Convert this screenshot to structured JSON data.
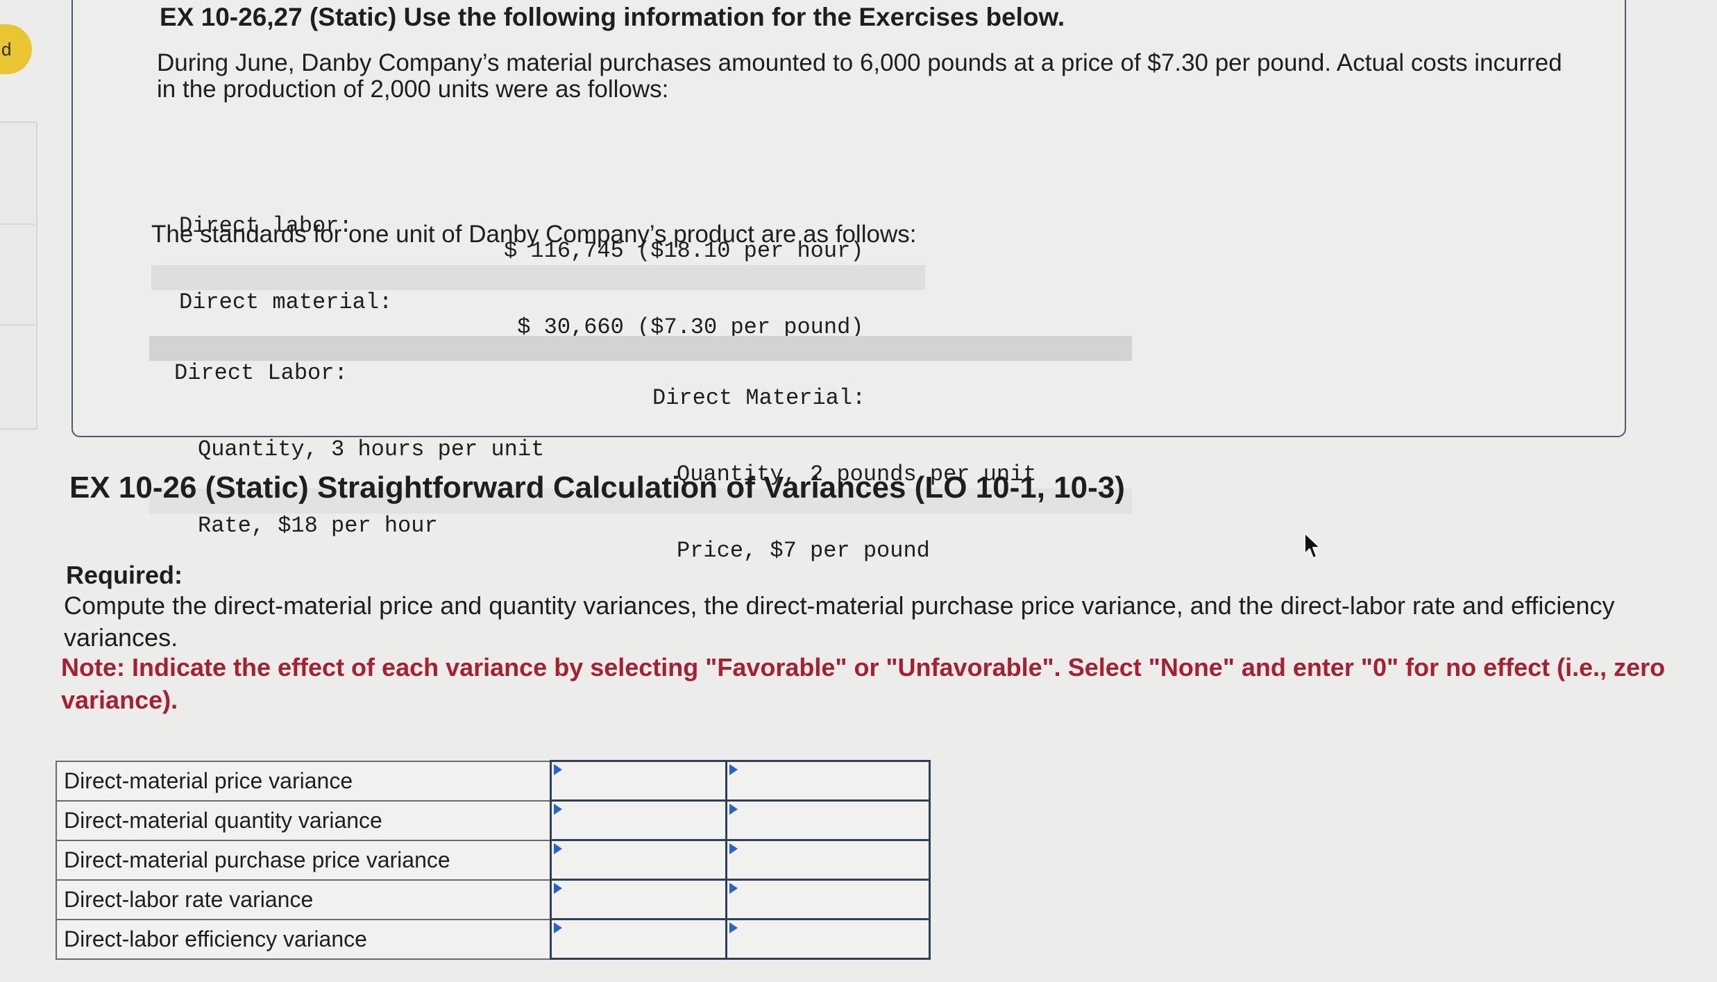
{
  "sidebar": {
    "badge": "d"
  },
  "exercise_header": "EX 10-26,27 (Static) Use the following information for the Exercises below.",
  "intro": "During June, Danby Company’s material purchases amounted to 6,000 pounds at a price of $7.30 per pound. Actual costs incurred in the production of 2,000 units were as follows:",
  "actual_costs": [
    {
      "label": "Direct labor:",
      "value": "$ 116,745 ($18.10 per hour)"
    },
    {
      "label": "Direct material:",
      "value": " $ 30,660 ($7.30 per pound)"
    }
  ],
  "standards_intro": "The standards for one unit of Danby Company’s product are as follows:",
  "standards": {
    "labor": {
      "heading": "Direct Labor:",
      "quantity": "Quantity, 3 hours per unit",
      "rate": "Rate, $18 per hour"
    },
    "material": {
      "heading": "Direct Material:",
      "quantity": "Quantity, 2 pounds per unit",
      "price": "Price, $7 per pound"
    }
  },
  "exercise_title": "EX 10-26 (Static) Straightforward Calculation of Variances (LO 10-1, 10-3)",
  "required_label": "Required:",
  "required_text": "Compute the direct-material price and quantity variances, the direct-material purchase price variance, and the direct-labor rate and efficiency variances.",
  "note": "Note: Indicate the effect of each variance by selecting \"Favorable\" or \"Unfavorable\". Select \"None\" and enter \"0\" for no effect (i.e., zero variance).",
  "answer_rows": [
    {
      "label": "Direct-material price variance",
      "amount": "",
      "effect": ""
    },
    {
      "label": "Direct-material quantity variance",
      "amount": "",
      "effect": ""
    },
    {
      "label": "Direct-material purchase price variance",
      "amount": "",
      "effect": ""
    },
    {
      "label": "Direct-labor rate variance",
      "amount": "",
      "effect": ""
    },
    {
      "label": "Direct-labor efficiency variance",
      "amount": "",
      "effect": ""
    }
  ],
  "colors": {
    "note": "#a62030",
    "cell_border": "#2f3f57",
    "dropdown_marker": "#2a62c9",
    "badge": "#e9c532"
  },
  "icons": {
    "cursor": "mouse-pointer-icon",
    "dropdown": "dropdown-triangle-icon"
  }
}
